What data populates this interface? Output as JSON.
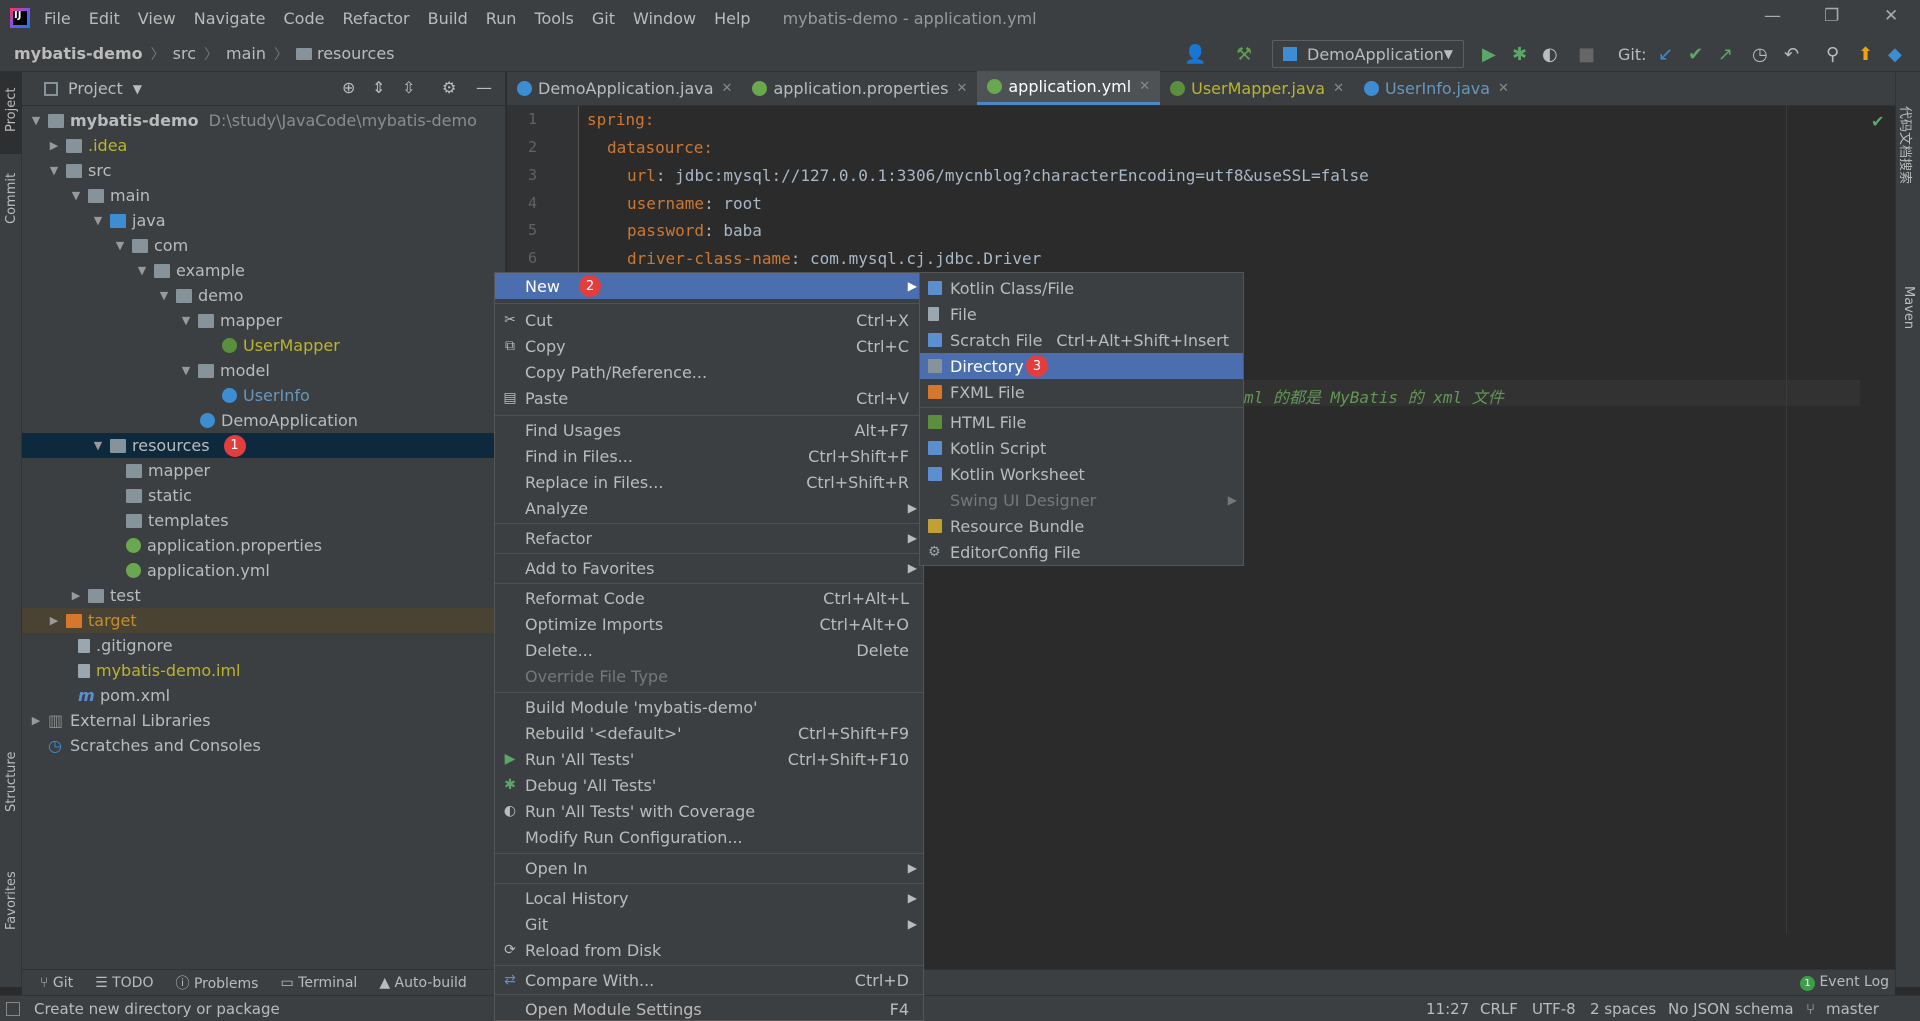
{
  "menubar": {
    "items": [
      "File",
      "Edit",
      "View",
      "Navigate",
      "Code",
      "Refactor",
      "Build",
      "Run",
      "Tools",
      "Git",
      "Window",
      "Help"
    ],
    "title": "mybatis-demo - application.yml"
  },
  "navbar": {
    "project": "mybatis-demo",
    "src": "src",
    "main": "main",
    "resources": "resources",
    "run_config": "DemoApplication",
    "git_label": "Git:"
  },
  "left_strip": {
    "project": "Project",
    "commit": "Commit",
    "structure": "Structure",
    "favorites": "Favorites"
  },
  "right_strip": {
    "plugin": "代码文档搜索",
    "maven": "Maven"
  },
  "project_panel": {
    "title": "Project",
    "tree": [
      {
        "label": "mybatis-demo",
        "extra": "D:\\study\\JavaCode\\mybatis-demo"
      },
      {
        "label": ".idea"
      },
      {
        "label": "src"
      },
      {
        "label": "main"
      },
      {
        "label": "java"
      },
      {
        "label": "com"
      },
      {
        "label": "example"
      },
      {
        "label": "demo"
      },
      {
        "label": "mapper"
      },
      {
        "label": "UserMapper"
      },
      {
        "label": "model"
      },
      {
        "label": "UserInfo"
      },
      {
        "label": "DemoApplication"
      },
      {
        "label": "resources",
        "badge": "1"
      },
      {
        "label": "mapper"
      },
      {
        "label": "static"
      },
      {
        "label": "templates"
      },
      {
        "label": "application.properties"
      },
      {
        "label": "application.yml"
      },
      {
        "label": "test"
      },
      {
        "label": "target"
      },
      {
        "label": ".gitignore"
      },
      {
        "label": "mybatis-demo.iml"
      },
      {
        "label": "pom.xml"
      },
      {
        "label": "External Libraries"
      },
      {
        "label": "Scratches and Consoles"
      }
    ]
  },
  "tabs": [
    "DemoApplication.java",
    "application.properties",
    "application.yml",
    "UserMapper.java",
    "UserInfo.java"
  ],
  "editor": {
    "line_numbers": [
      "1",
      "2",
      "3",
      "4",
      "5",
      "6"
    ],
    "lines": [
      {
        "key": "spring",
        "sep": ":",
        "val": ""
      },
      {
        "key": "datasource",
        "sep": ":",
        "val": ""
      },
      {
        "key": "url",
        "sep": ": ",
        "val": "jdbc:mysql://127.0.0.1:3306/mycnblog?characterEncoding=utf8&useSSL=false"
      },
      {
        "key": "username",
        "sep": ": ",
        "val": "root"
      },
      {
        "key": "password",
        "sep": ": ",
        "val": "baba"
      },
      {
        "key": "driver-class-name",
        "sep": ": ",
        "val": "com.mysql.cj.jdbc.Driver"
      }
    ],
    "comment_fragment": "ml 的都是 MyBatis 的 xml 文件"
  },
  "context_menu": {
    "items": [
      {
        "label": "New",
        "sub": true,
        "badge": "2"
      },
      {
        "label": "Cut",
        "shortcut": "Ctrl+X",
        "icon": "✂"
      },
      {
        "label": "Copy",
        "shortcut": "Ctrl+C",
        "icon": "⧉"
      },
      {
        "label": "Copy Path/Reference..."
      },
      {
        "label": "Paste",
        "shortcut": "Ctrl+V",
        "icon": "📋"
      },
      {
        "label": "Find Usages",
        "shortcut": "Alt+F7"
      },
      {
        "label": "Find in Files...",
        "shortcut": "Ctrl+Shift+F"
      },
      {
        "label": "Replace in Files...",
        "shortcut": "Ctrl+Shift+R"
      },
      {
        "label": "Analyze",
        "sub": true
      },
      {
        "label": "Refactor",
        "sub": true
      },
      {
        "label": "Add to Favorites",
        "sub": true
      },
      {
        "label": "Reformat Code",
        "shortcut": "Ctrl+Alt+L"
      },
      {
        "label": "Optimize Imports",
        "shortcut": "Ctrl+Alt+O"
      },
      {
        "label": "Delete...",
        "shortcut": "Delete"
      },
      {
        "label": "Override File Type",
        "disabled": true
      },
      {
        "label": "Build Module 'mybatis-demo'"
      },
      {
        "label": "Rebuild '<default>'",
        "shortcut": "Ctrl+Shift+F9"
      },
      {
        "label": "Run 'All Tests'",
        "shortcut": "Ctrl+Shift+F10",
        "icon": "▶"
      },
      {
        "label": "Debug 'All Tests'",
        "icon": "✱"
      },
      {
        "label": "Run 'All Tests' with Coverage",
        "icon": "◐"
      },
      {
        "label": "Modify Run Configuration..."
      },
      {
        "label": "Open In",
        "sub": true
      },
      {
        "label": "Local History",
        "sub": true
      },
      {
        "label": "Git",
        "sub": true
      },
      {
        "label": "Reload from Disk",
        "icon": "⟳"
      },
      {
        "label": "Compare With...",
        "shortcut": "Ctrl+D",
        "icon": "⇄"
      },
      {
        "label": "Open Module Settings",
        "shortcut": "F4"
      }
    ]
  },
  "sub_menu": {
    "items": [
      {
        "label": "Kotlin Class/File",
        "color": "#5c8fd0"
      },
      {
        "label": "File",
        "color": "#9aa7b0"
      },
      {
        "label": "Scratch File",
        "shortcut": "Ctrl+Alt+Shift+Insert",
        "color": "#5c8fd0"
      },
      {
        "label": "Directory",
        "badge": "3",
        "color": "#87939a"
      },
      {
        "label": "FXML File",
        "color": "#d7772c"
      },
      {
        "label": "HTML File",
        "color": "#5b8f3e"
      },
      {
        "label": "Kotlin Script",
        "color": "#5c8fd0"
      },
      {
        "label": "Kotlin Worksheet",
        "color": "#5c8fd0"
      },
      {
        "label": "Swing UI Designer",
        "disabled": true,
        "sub": true
      },
      {
        "label": "Resource Bundle",
        "color": "#c3a032"
      },
      {
        "label": "EditorConfig File",
        "color": "#9aa7b0"
      }
    ]
  },
  "tool_windows": [
    "Git",
    "TODO",
    "Problems",
    "Terminal",
    "Auto-build"
  ],
  "event_log": "Event Log",
  "event_log_count": "1",
  "status": {
    "message": "Create new directory or package",
    "position": "11:27",
    "line_sep": "CRLF",
    "encoding": "UTF-8",
    "indent": "2 spaces",
    "schema": "No JSON schema",
    "branch": "master"
  },
  "colors": {
    "selection": "#4b6eaf",
    "badge": "#e33e3e",
    "tree_selected": "#0d293e"
  }
}
